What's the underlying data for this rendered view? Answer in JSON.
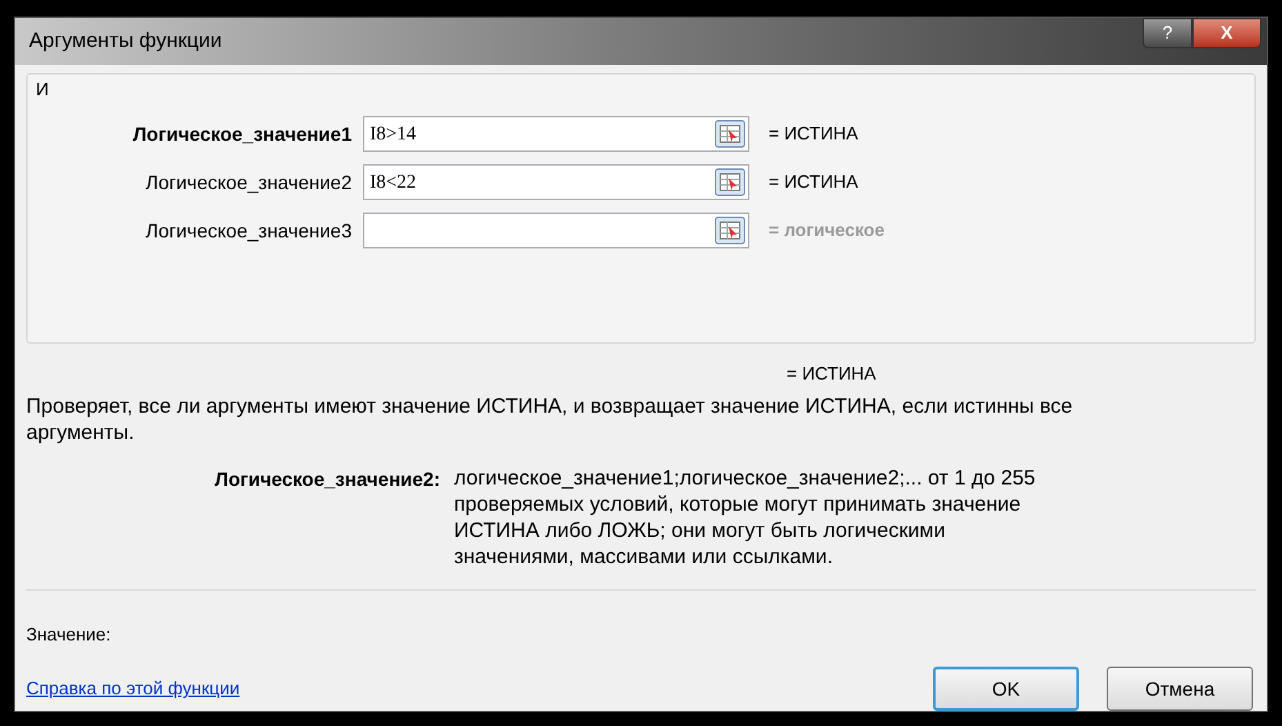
{
  "window": {
    "title": "Аргументы функции",
    "help_button": "?",
    "close_button": "X"
  },
  "function_name": "И",
  "arguments": [
    {
      "label": "Логическое_значение1",
      "current": true,
      "value": "I8>14",
      "result": "= ИСТИНА",
      "muted": false
    },
    {
      "label": "Логическое_значение2",
      "current": false,
      "value": "I8<22",
      "result": "= ИСТИНА",
      "muted": false
    },
    {
      "label": "Логическое_значение3",
      "current": false,
      "result": "= логическое",
      "muted": true
    }
  ],
  "formula_result": "= ИСТИНА",
  "description": "Проверяет, все ли аргументы имеют значение ИСТИНА, и возвращает значение ИСТИНА, если истинны все аргументы.",
  "argument_help": {
    "label": "Логическое_значение2:",
    "text": "логическое_значение1;логическое_значение2;... от 1 до 255 проверяемых условий, которые могут принимать значение ИСТИНА либо ЛОЖЬ; они могут быть логическими значениями, массивами или ссылками."
  },
  "value_label": "Значение:",
  "help_link": "Справка по этой функции",
  "buttons": [
    {
      "label": "OK",
      "default": true
    },
    {
      "label": "Отмена",
      "default": false
    }
  ]
}
